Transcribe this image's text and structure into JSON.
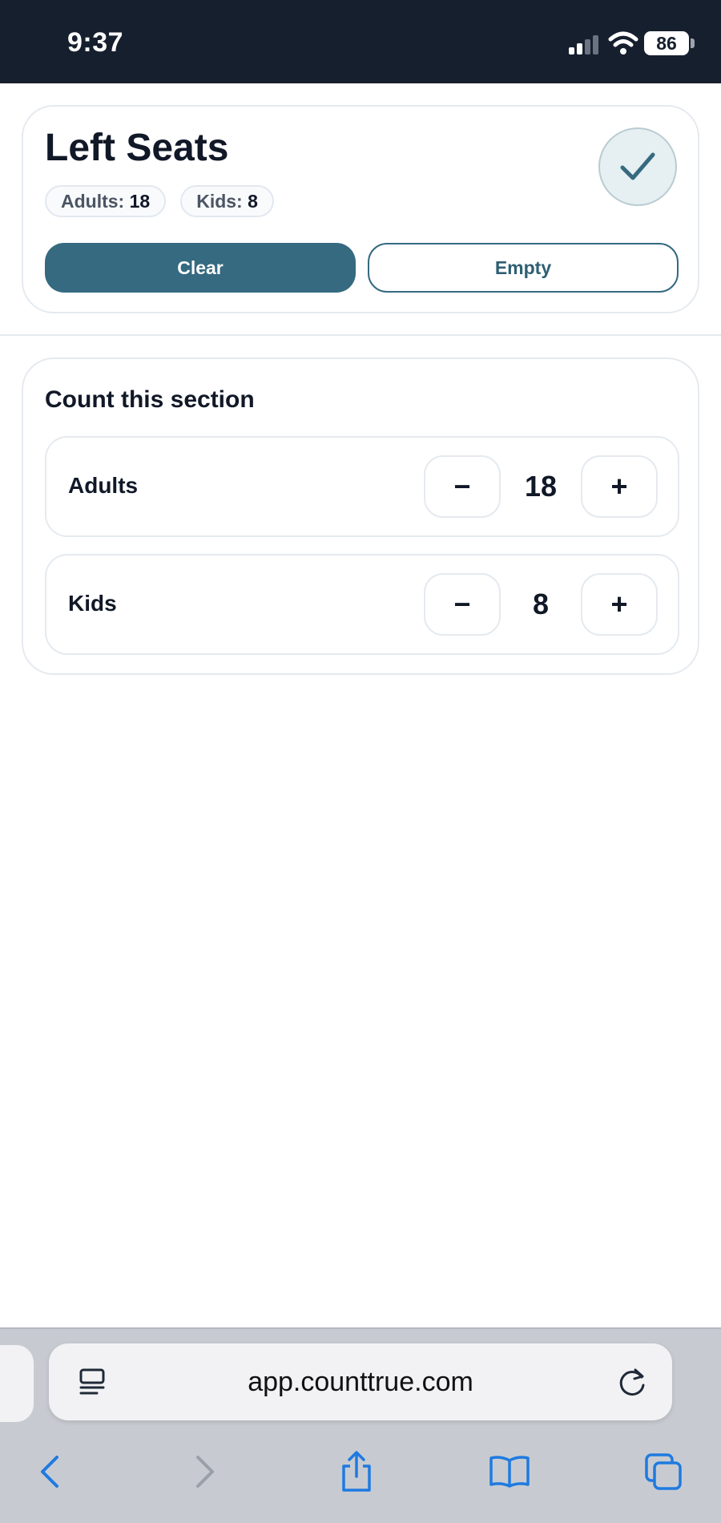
{
  "status_bar": {
    "time": "9:37",
    "battery": "86"
  },
  "header": {
    "title": "Left Seats",
    "chips": [
      {
        "label": "Adults:",
        "value": "18"
      },
      {
        "label": "Kids:",
        "value": "8"
      }
    ],
    "clear_label": "Clear",
    "empty_label": "Empty",
    "done_icon": "checkmark-icon"
  },
  "count_section": {
    "heading": "Count this section",
    "counters": [
      {
        "label": "Adults",
        "value": "18",
        "minus": "−",
        "plus": "+"
      },
      {
        "label": "Kids",
        "value": "8",
        "minus": "−",
        "plus": "+"
      }
    ]
  },
  "browser": {
    "url": "app.counttrue.com",
    "icons": [
      "reader-icon",
      "reload-icon",
      "back-icon",
      "forward-icon",
      "share-icon",
      "bookmarks-icon",
      "tabs-icon"
    ]
  },
  "colors": {
    "accent": "#356a80",
    "status_bar_bg": "#151f2e",
    "browser_blue": "#1f7ae0"
  }
}
